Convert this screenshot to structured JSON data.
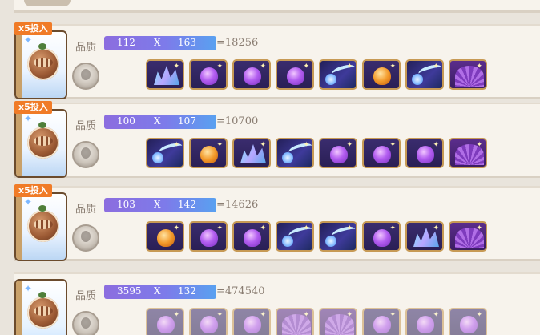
{
  "badge_text": "x5投入",
  "quality_label": "品质",
  "rows": [
    {
      "badge": true,
      "a": "112",
      "x": "X",
      "b": "163",
      "total": "=18256",
      "items": [
        "crystal-cauldron-icon",
        "violet-potion-icon",
        "violet-potion-icon",
        "violet-potion-icon",
        "comet-icon",
        "orange-potion-icon",
        "comet-icon",
        "fan-book-icon"
      ]
    },
    {
      "badge": true,
      "a": "100",
      "x": "X",
      "b": "107",
      "total": "=10700",
      "items": [
        "comet-icon",
        "orange-potion-icon",
        "crystal-cauldron-icon",
        "comet-icon",
        "violet-potion-icon",
        "violet-potion-icon",
        "violet-potion-icon",
        "fan-book-icon"
      ]
    },
    {
      "badge": true,
      "a": "103",
      "x": "X",
      "b": "142",
      "total": "=14626",
      "items": [
        "orange-potion-icon",
        "violet-potion-icon",
        "violet-potion-icon",
        "comet-icon",
        "comet-icon",
        "violet-potion-icon",
        "crystal-cauldron-icon",
        "fan-book-icon"
      ]
    },
    {
      "badge": false,
      "a": "3595",
      "x": "X",
      "b": "132",
      "total": "=474540",
      "items": [
        "violet-potion-icon",
        "violet-potion-icon",
        "violet-potion-icon",
        "fan-book-icon",
        "fan-book-icon",
        "violet-potion-icon",
        "violet-potion-icon",
        "violet-potion-icon"
      ]
    }
  ]
}
